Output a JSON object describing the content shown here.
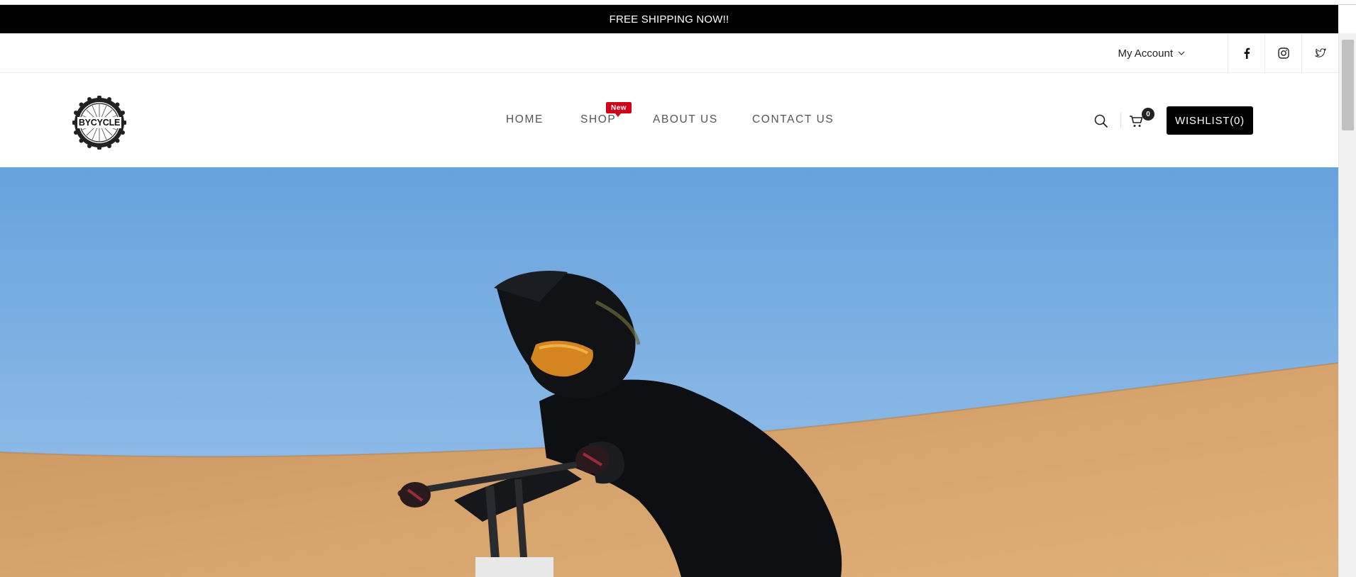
{
  "announcement": {
    "text": "FREE SHIPPING NOW!!"
  },
  "topbar": {
    "account_label": "My Account",
    "social": [
      {
        "icon": "facebook-icon"
      },
      {
        "icon": "instagram-icon"
      },
      {
        "icon": "twitter-icon"
      }
    ]
  },
  "header": {
    "logo_text": "BYCYCLE",
    "nav": [
      {
        "label": "HOME"
      },
      {
        "label": "SHOP",
        "badge": "New"
      },
      {
        "label": "ABOUT US"
      },
      {
        "label": "CONTACT US"
      }
    ],
    "cart_count": "0",
    "wishlist_label": "WISHLIST(0)"
  },
  "hero": {
    "image": "rider-on-motorbike-in-desert-dunes"
  },
  "colors": {
    "announcement_bg": "#000000",
    "badge": "#d0021b",
    "wishlist_bg": "#000000",
    "sky": "#6ea8df",
    "sand": "#d4a06a"
  }
}
